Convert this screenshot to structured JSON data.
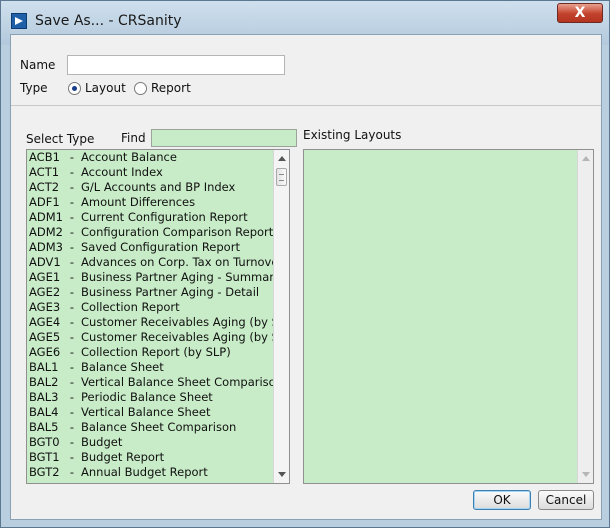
{
  "window": {
    "title": "Save As...  -  CRSanity",
    "close_glyph": "X"
  },
  "form": {
    "name_label": "Name",
    "name_value": "",
    "type_label": "Type",
    "type_options": [
      "Layout",
      "Report"
    ],
    "type_selected": "Layout"
  },
  "select_type": {
    "label": "Select Type",
    "find_label": "Find",
    "find_value": "",
    "items": [
      {
        "code": "ACB1",
        "name": "Account Balance"
      },
      {
        "code": "ACT1",
        "name": "Account Index"
      },
      {
        "code": "ACT2",
        "name": "G/L Accounts and BP Index"
      },
      {
        "code": "ADF1",
        "name": "Amount Differences"
      },
      {
        "code": "ADM1",
        "name": "Current Configuration Report"
      },
      {
        "code": "ADM2",
        "name": "Configuration Comparison Report"
      },
      {
        "code": "ADM3",
        "name": "Saved Configuration Report"
      },
      {
        "code": "ADV1",
        "name": "Advances on Corp. Tax on Turnove"
      },
      {
        "code": "AGE1",
        "name": "Business Partner Aging - Summary"
      },
      {
        "code": "AGE2",
        "name": "Business Partner Aging - Detail"
      },
      {
        "code": "AGE3",
        "name": "Collection Report"
      },
      {
        "code": "AGE4",
        "name": "Customer Receivables Aging (by SL"
      },
      {
        "code": "AGE5",
        "name": "Customer Receivables Aging (by SL"
      },
      {
        "code": "AGE6",
        "name": "Collection Report (by SLP)"
      },
      {
        "code": "BAL1",
        "name": "Balance Sheet"
      },
      {
        "code": "BAL2",
        "name": "Vertical Balance Sheet Comparison"
      },
      {
        "code": "BAL3",
        "name": "Periodic Balance Sheet"
      },
      {
        "code": "BAL4",
        "name": "Vertical Balance Sheet"
      },
      {
        "code": "BAL5",
        "name": "Balance Sheet Comparison"
      },
      {
        "code": "BGT0",
        "name": "Budget"
      },
      {
        "code": "BGT1",
        "name": "Budget Report"
      },
      {
        "code": "BGT2",
        "name": "Annual Budget Report"
      }
    ],
    "separator": "-"
  },
  "existing": {
    "label": "Existing Layouts"
  },
  "buttons": {
    "ok": "OK",
    "cancel": "Cancel"
  }
}
